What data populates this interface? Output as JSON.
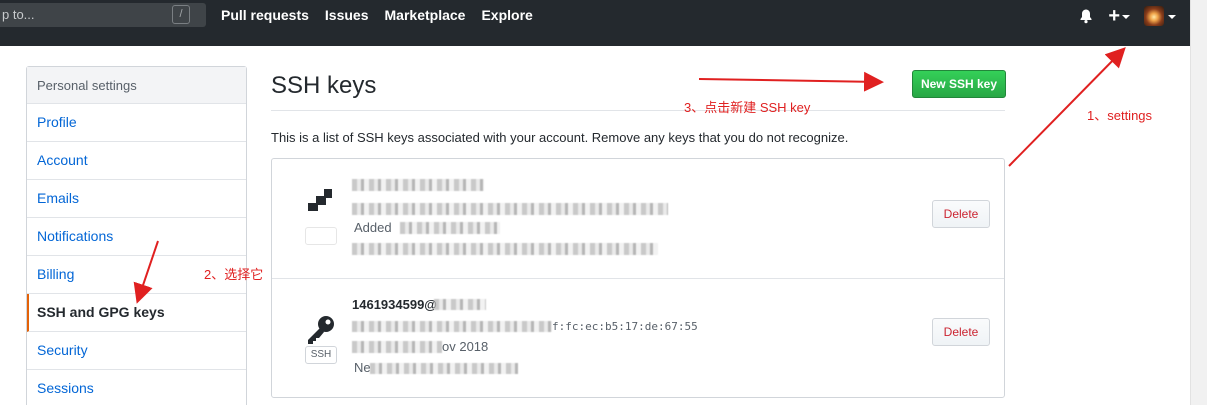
{
  "header": {
    "search_placeholder": "p to...",
    "search_shortcut": "/",
    "nav": [
      "Pull requests",
      "Issues",
      "Marketplace",
      "Explore"
    ],
    "plus_label": "+"
  },
  "sidebar": {
    "heading": "Personal settings",
    "items": [
      {
        "label": "Profile"
      },
      {
        "label": "Account"
      },
      {
        "label": "Emails"
      },
      {
        "label": "Notifications"
      },
      {
        "label": "Billing"
      },
      {
        "label": "SSH and GPG keys",
        "selected": true
      },
      {
        "label": "Security"
      },
      {
        "label": "Sessions"
      }
    ]
  },
  "main": {
    "title": "SSH keys",
    "new_button": "New SSH key",
    "description": "This is a list of SSH keys associated with your account. Remove any keys that you do not recognize.",
    "keys": [
      {
        "added_label": "Added",
        "type_label": "",
        "delete_label": "Delete",
        "fingerprint_tail": "",
        "last_used_tail": "",
        "date_tail": "",
        "title_prefix": ""
      },
      {
        "title_prefix": "1461934599@",
        "fingerprint_tail": "f:fc:ec:b5:17:de:67:55",
        "date_tail": "ov 2018",
        "type_label": "SSH",
        "delete_label": "Delete",
        "last_used_prefix": "Ne"
      }
    ]
  },
  "annotations": {
    "step1": "1、settings",
    "step2": "2、选择它",
    "step3": "3、点击新建 SSH key",
    "color": "#e02020"
  }
}
